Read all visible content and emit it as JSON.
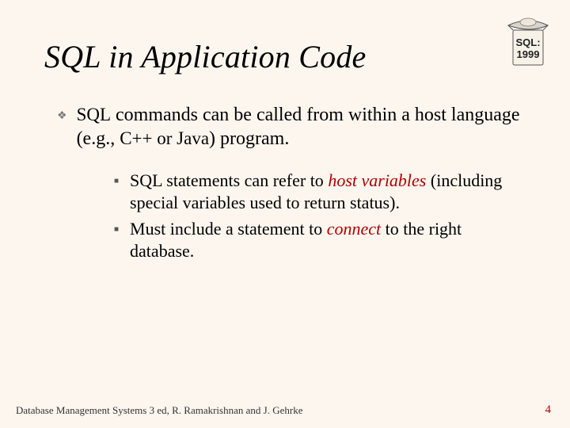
{
  "slide": {
    "title": "SQL in Application Code",
    "bullets": [
      {
        "pre": "SQL",
        "text_rest": " commands can be called from within a host language (e.g., ",
        "code2": "C++ or Java",
        "text_end": ") program."
      }
    ],
    "sub_bullets": [
      {
        "pre": "SQL statements can refer to ",
        "em": "host variables",
        "post": " (including special variables used to return status)."
      },
      {
        "pre": "Must include a statement to ",
        "em": "connect",
        "post": " to the right database."
      }
    ],
    "footer_left": "Database Management Systems 3 ed, R. Ramakrishnan and J. Gehrke",
    "page_number": "4",
    "icon_label": "SQL: 1999",
    "icon_line1": "SQL:",
    "icon_line2": "1999"
  }
}
